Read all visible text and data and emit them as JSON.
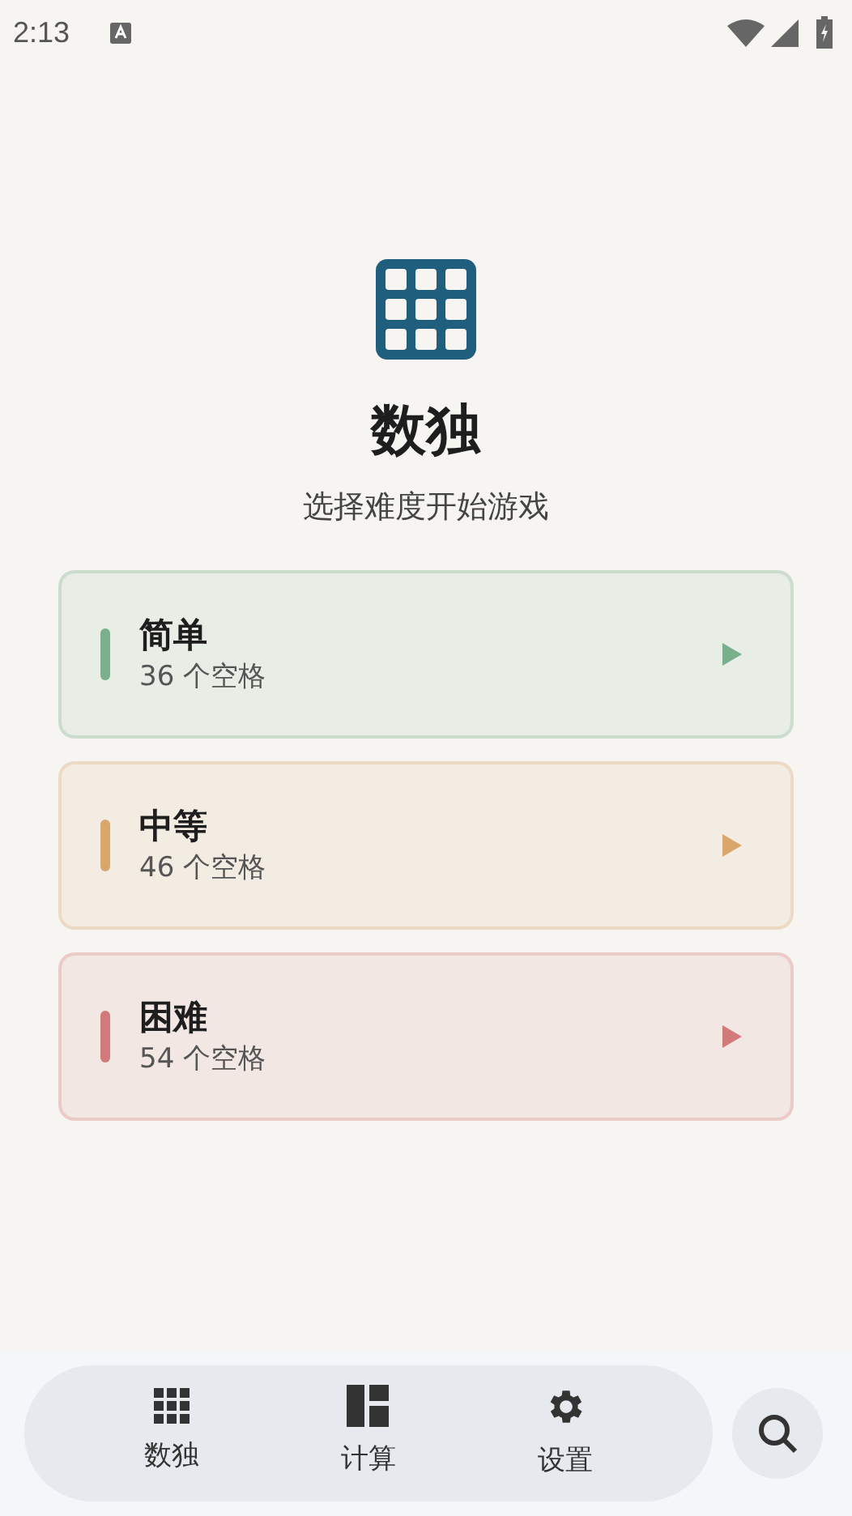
{
  "status_bar": {
    "time": "2:13"
  },
  "header": {
    "title": "数独",
    "subtitle": "选择难度开始游戏"
  },
  "levels": [
    {
      "name": "简单",
      "detail": "36 个空格",
      "color": "#7aae8c"
    },
    {
      "name": "中等",
      "detail": "46 个空格",
      "color": "#d9a66c"
    },
    {
      "name": "困难",
      "detail": "54 个空格",
      "color": "#d27a7a"
    }
  ],
  "nav": [
    {
      "kind": "grid",
      "label": "数独"
    },
    {
      "kind": "dashboard",
      "label": "计算"
    },
    {
      "kind": "gear",
      "label": "设置"
    }
  ]
}
